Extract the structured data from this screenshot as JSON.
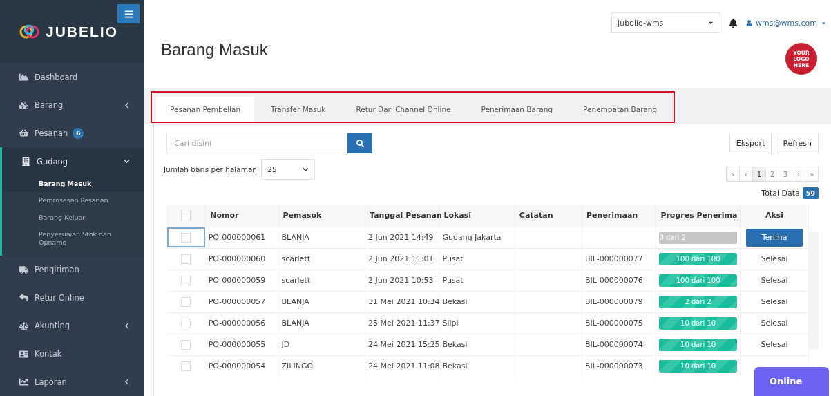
{
  "sidebar": {
    "brand": "JUBELIO",
    "items": [
      {
        "label": "Dashboard",
        "kind": "link",
        "expanded": false
      },
      {
        "label": "Barang",
        "kind": "menu",
        "expanded": false
      },
      {
        "label": "Pesanan",
        "kind": "link",
        "expanded": false,
        "badge": "6"
      },
      {
        "label": "Gudang",
        "kind": "menu",
        "expanded": true,
        "children": [
          {
            "label": "Barang Masuk",
            "selected": true
          },
          {
            "label": "Pemrosesan Pesanan",
            "selected": false
          },
          {
            "label": "Barang Keluar",
            "selected": false
          },
          {
            "label": "Penyesuaian Stok dan Opname",
            "selected": false
          }
        ]
      },
      {
        "label": "Pengiriman",
        "kind": "link",
        "expanded": false
      },
      {
        "label": "Retur Online",
        "kind": "link",
        "expanded": false
      },
      {
        "label": "Akunting",
        "kind": "menu",
        "expanded": false
      },
      {
        "label": "Kontak",
        "kind": "link",
        "expanded": false
      },
      {
        "label": "Laporan",
        "kind": "menu",
        "expanded": false
      }
    ]
  },
  "header": {
    "company": "jubelio-wms",
    "user": "wms@wms.com",
    "title": "Barang Masuk",
    "logo_lines": [
      "YOUR",
      "LOGO",
      "HERE"
    ]
  },
  "tabs": [
    {
      "label": "Pesanan Pembelian",
      "selected": true
    },
    {
      "label": "Transfer Masuk",
      "selected": false
    },
    {
      "label": "Retur Dari Channel Online",
      "selected": false
    },
    {
      "label": "Penerimaan Barang",
      "selected": false
    },
    {
      "label": "Penempatan Barang",
      "selected": false
    }
  ],
  "search": {
    "placeholder": "Cari disini"
  },
  "buttons": [
    "Eksport",
    "Refresh"
  ],
  "page_size": {
    "label": "Jumlah baris per halaman",
    "value": "25"
  },
  "pagination": [
    {
      "label": "«",
      "selected": false
    },
    {
      "label": "‹",
      "selected": false
    },
    {
      "label": "1",
      "selected": true
    },
    {
      "label": "2",
      "selected": false
    },
    {
      "label": "3",
      "selected": false
    },
    {
      "label": "›",
      "selected": false
    },
    {
      "label": "»",
      "selected": false
    }
  ],
  "total": {
    "label": "Total Data",
    "count": "59"
  },
  "table": {
    "all_checked": false,
    "columns": [
      "Nomor",
      "Pemasok",
      "Tanggal Pesanan",
      "Lokasi",
      "Catatan",
      "Penerimaan",
      "Progres Penerima",
      "Aksi"
    ],
    "rows": [
      {
        "checked": false,
        "nomor": "PO-000000061",
        "pemasok": "BLANJA",
        "tanggal": "2 Jun 2021 14:49",
        "lokasi": "Gudang Jakarta",
        "penerimaan": "",
        "progress": "0 dari 2",
        "level": 0,
        "action": {
          "kind": "button",
          "label": "Terima"
        }
      },
      {
        "checked": false,
        "nomor": "PO-000000060",
        "pemasok": "scarlett",
        "tanggal": "2 Jun 2021 11:01",
        "lokasi": "Pusat",
        "penerimaan": "BIL-000000077",
        "progress": "100 dari 100",
        "level": 1,
        "action": {
          "kind": "text",
          "label": "Selesai"
        }
      },
      {
        "checked": false,
        "nomor": "PO-000000059",
        "pemasok": "scarlett",
        "tanggal": "2 Jun 2021 10:53",
        "lokasi": "Pusat",
        "penerimaan": "BIL-000000076",
        "progress": "100 dari 100",
        "level": 1,
        "action": {
          "kind": "text",
          "label": "Selesai"
        }
      },
      {
        "checked": false,
        "nomor": "PO-000000057",
        "pemasok": "BLANJA",
        "tanggal": "31 Mei 2021 10:34",
        "lokasi": "Bekasi",
        "penerimaan": "BIL-000000079",
        "progress": "2 dari 2",
        "level": 1,
        "action": {
          "kind": "text",
          "label": "Selesai"
        }
      },
      {
        "checked": false,
        "nomor": "PO-000000056",
        "pemasok": "BLANJA",
        "tanggal": "25 Mei 2021 11:37",
        "lokasi": "Slipi",
        "penerimaan": "BIL-000000075",
        "progress": "10 dari 10",
        "level": 1,
        "action": {
          "kind": "text",
          "label": "Selesai"
        }
      },
      {
        "checked": false,
        "nomor": "PO-000000055",
        "pemasok": "JD",
        "tanggal": "24 Mei 2021 15:25",
        "lokasi": "Bekasi",
        "penerimaan": "BIL-000000074",
        "progress": "10 dari 10",
        "level": 1,
        "action": {
          "kind": "text",
          "label": "Selesai"
        }
      },
      {
        "checked": false,
        "nomor": "PO-000000054",
        "pemasok": "ZILINGO",
        "tanggal": "24 Mei 2021 11:08",
        "lokasi": "Bekasi",
        "penerimaan": "BIL-000000073",
        "progress": "10 dari 10",
        "level": 1
      }
    ]
  },
  "chat": {
    "label": "Online"
  }
}
